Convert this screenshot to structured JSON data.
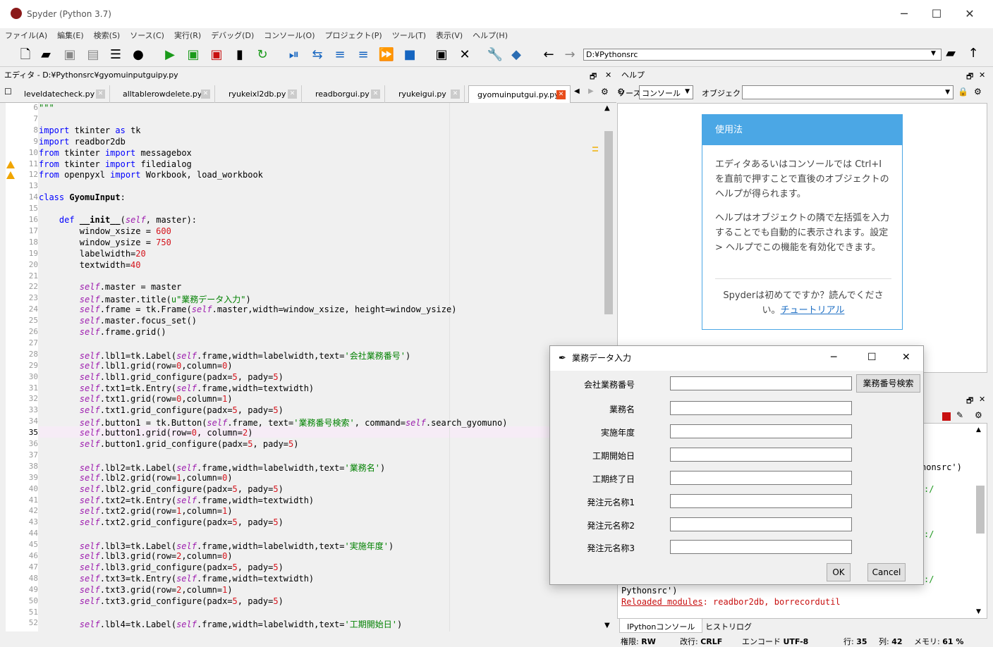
{
  "window": {
    "title": "Spyder (Python 3.7)"
  },
  "menu": [
    "ファイル(A)",
    "編集(E)",
    "検索(S)",
    "ソース(C)",
    "実行(R)",
    "デバッグ(D)",
    "コンソール(O)",
    "プロジェクト(P)",
    "ツール(T)",
    "表示(V)",
    "ヘルプ(H)"
  ],
  "toolbar": {
    "path": "D:¥Pythonsrc"
  },
  "editor": {
    "pane_title": "エディタ - D:¥Pythonsrc¥gyomuinputguipy.py",
    "tabs": [
      "leveldatecheck.py",
      "alltablerowdelete.py",
      "ryukeixl2db.py",
      "readborgui.py",
      "ryukeigui.py",
      "gyomuinputgui.py.py"
    ],
    "active_tab": "gyomuinputgui.py.py",
    "current_line": "35",
    "line_numbers": [
      "6",
      "7",
      "8",
      "9",
      "10",
      "11",
      "12",
      "13",
      "14",
      "15",
      "16",
      "17",
      "18",
      "19",
      "20",
      "21",
      "22",
      "23",
      "24",
      "25",
      "26",
      "27",
      "28",
      "29",
      "30",
      "31",
      "32",
      "33",
      "34",
      "35",
      "36",
      "37",
      "38",
      "39",
      "40",
      "41",
      "42",
      "43",
      "44",
      "45",
      "46",
      "47",
      "48",
      "49",
      "50",
      "51",
      "52"
    ]
  },
  "help": {
    "pane_title": "ヘルプ",
    "source_label": "ソース",
    "source_value": "コンソール",
    "object_label": "オブジェクト",
    "card_title": "使用法",
    "p1": "エディタあるいはコンソールでは Ctrl+I を直前で押すことで直後のオブジェクトのヘルプが得られます。",
    "p2": "ヘルプはオブジェクトの隣で左括弧を入力することでも自動的に表示されます。設定 > ヘルプでこの機能を有効化できます。",
    "p3": "Spyderは初めてですか？読んでください。",
    "tutorial_link": "チュートリアル"
  },
  "console": {
    "fragment1": "honsrc')",
    "fragment2": ":/",
    "fragment3": "Pythonsrc')",
    "reloaded": "Reloaded modules",
    "reloaded_rest": ": readbor2db, borrecordutil",
    "tabs": [
      "IPythonコンソール",
      "ヒストリログ"
    ]
  },
  "status": {
    "perm_label": "権限:",
    "perm": "RW",
    "eol_label": "改行:",
    "eol": "CRLF",
    "enc_label": "エンコード",
    "enc": "UTF-8",
    "line_label": "行:",
    "line": "35",
    "col_label": "列:",
    "col": "42",
    "mem_label": "メモリ:",
    "mem": "61 %"
  },
  "dialog": {
    "title": "業務データ入力",
    "fields": [
      "会社業務番号",
      "業務名",
      "実施年度",
      "工期開始日",
      "工期終了日",
      "発注元名称1",
      "発注元名称2",
      "発注元名称3"
    ],
    "search_button": "業務番号検索",
    "ok": "OK",
    "cancel": "Cancel"
  }
}
